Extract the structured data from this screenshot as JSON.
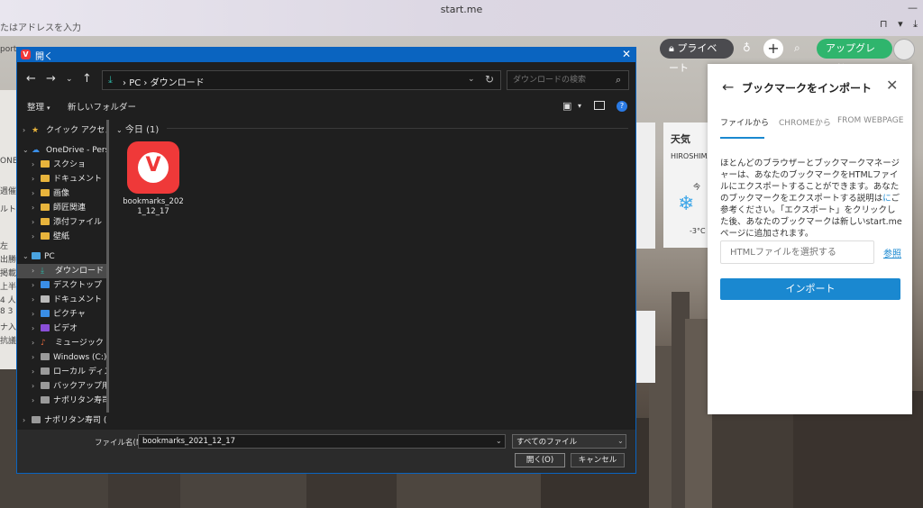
{
  "browser": {
    "title": "start.me",
    "address_hint": "たはアドレスを入力",
    "left_fragments": [
      "porte",
      "ONET",
      "週催",
      "ルト",
      "左",
      "出勝",
      "掲載",
      "上半",
      "4 人",
      "8 3",
      "ナ入",
      "抗議"
    ]
  },
  "startme": {
    "private_label": "プライベート",
    "upgrade_label": "アップグレード"
  },
  "weather": {
    "title": "天気",
    "location": "HIROSHIMA",
    "day": "今",
    "temp": "-3°C"
  },
  "import_panel": {
    "title": "ブックマークをインポート",
    "tabs": [
      {
        "label": "ファイルから",
        "active": true
      },
      {
        "label": "CHROMEから",
        "active": false
      },
      {
        "label": "FROM WEBPAGE",
        "active": false
      }
    ],
    "description_before": "ほとんどのブラウザーとブックマークマネージャーは、あなたのブックマークをHTMLファイルにエクスポートすることができます。あなたのブックマークをエクスポートする説明は",
    "description_link": "に",
    "description_after": "ご参考ください。「エクスポート」をクリックした後、あなたのブックマークは新しいstart.meページに追加されます。",
    "file_placeholder": "HTMLファイルを選択する",
    "browse_label": "参照",
    "import_button": "インポート"
  },
  "dialog": {
    "title": "開く",
    "path": [
      "PC",
      "ダウンロード"
    ],
    "search_placeholder": "ダウンロードの検索",
    "organize_label": "整理",
    "new_folder_label": "新しいフォルダー",
    "group_header": "今日 (1)",
    "file": {
      "name": "bookmarks_2021_12_17"
    },
    "nav_tree": [
      {
        "label": "クイック アクセス",
        "icon": "star-icon",
        "level": 0,
        "chev": "›"
      },
      {
        "label": "OneDrive - Person",
        "icon": "cloud-icon",
        "level": 0,
        "chev": "⌄"
      },
      {
        "label": "スクショ",
        "icon": "folder-icon",
        "level": 1,
        "chev": "›"
      },
      {
        "label": "ドキュメント",
        "icon": "folder-icon",
        "level": 1,
        "chev": "›"
      },
      {
        "label": "画像",
        "icon": "folder-icon",
        "level": 1,
        "chev": "›"
      },
      {
        "label": "師匠関連",
        "icon": "folder-icon",
        "level": 1,
        "chev": "›"
      },
      {
        "label": "添付ファイル",
        "icon": "folder-icon",
        "level": 1,
        "chev": "›"
      },
      {
        "label": "壁紙",
        "icon": "folder-icon",
        "level": 1,
        "chev": "›"
      },
      {
        "label": "PC",
        "icon": "pc-icon",
        "level": 0,
        "chev": "⌄"
      },
      {
        "label": "ダウンロード",
        "icon": "download-icon",
        "level": 1,
        "chev": "›",
        "selected": true
      },
      {
        "label": "デスクトップ",
        "icon": "desktop-icon",
        "level": 1,
        "chev": "›"
      },
      {
        "label": "ドキュメント",
        "icon": "document-icon",
        "level": 1,
        "chev": "›"
      },
      {
        "label": "ピクチャ",
        "icon": "picture-icon",
        "level": 1,
        "chev": "›"
      },
      {
        "label": "ビデオ",
        "icon": "video-icon",
        "level": 1,
        "chev": "›"
      },
      {
        "label": "ミュージック",
        "icon": "music-icon",
        "level": 1,
        "chev": "›"
      },
      {
        "label": "Windows (C:)",
        "icon": "drive-icon",
        "level": 1,
        "chev": "›"
      },
      {
        "label": "ローカル ディスク",
        "icon": "drive-icon",
        "level": 1,
        "chev": "›"
      },
      {
        "label": "バックアップ用HD",
        "icon": "drive-icon",
        "level": 1,
        "chev": "›"
      },
      {
        "label": "ナポリタン寿司 (I",
        "icon": "drive-icon",
        "level": 1,
        "chev": "›"
      },
      {
        "label": "ナポリタン寿司 (F:)",
        "icon": "drive-icon",
        "level": 0,
        "chev": "›"
      }
    ],
    "filename_label": "ファイル名(N):",
    "filename_value": "bookmarks_2021_12_17",
    "filetype_value": "すべてのファイル",
    "open_button": "開く(O)",
    "cancel_button": "キャンセル"
  },
  "colors": {
    "dialog_accent": "#0a64c0",
    "import_blue": "#1a88d0",
    "upgrade_green": "#2fb56d",
    "vivaldi_red": "#ef3939"
  }
}
